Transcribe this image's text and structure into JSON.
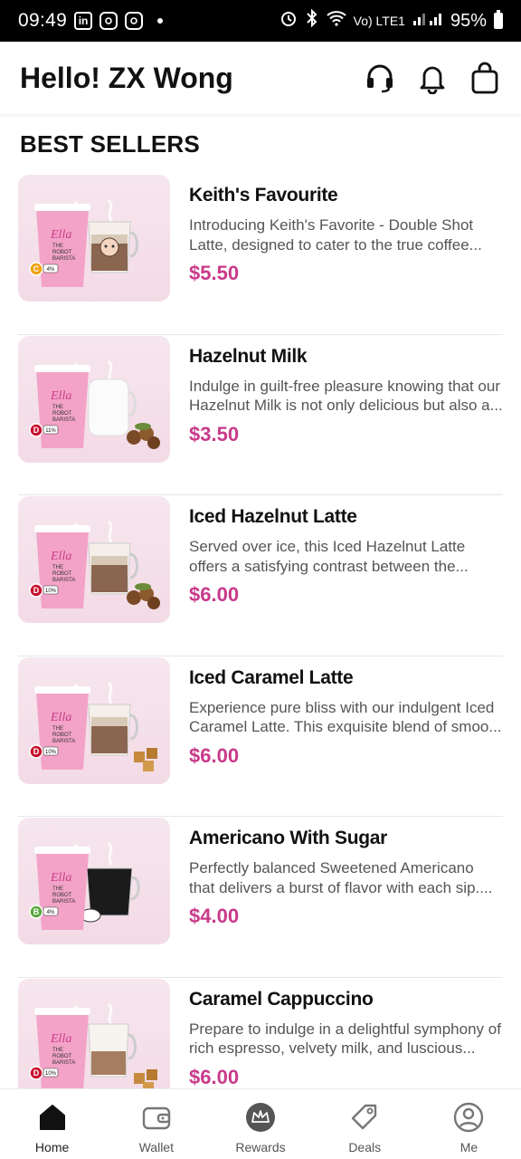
{
  "status_bar": {
    "time": "09:49",
    "battery": "95%",
    "network": "Vo) LTE1"
  },
  "header": {
    "greeting": "Hello! ZX Wong",
    "icons": [
      "headset-icon",
      "bell-icon",
      "bag-icon"
    ]
  },
  "section": {
    "title": "BEST SELLERS"
  },
  "products": [
    {
      "name": "Keith's Favourite",
      "description": "Introducing Keith's Favorite - Double Shot Latte, designed to cater to the true coffee...",
      "price": "$5.50",
      "badge": "C",
      "badge_color": "#f2a20a",
      "badge_pct": "4%",
      "side": "latte-glass-face",
      "garnish": ""
    },
    {
      "name": "Hazelnut Milk",
      "description": "Indulge in guilt-free pleasure knowing that our Hazelnut Milk is not only delicious but also a...",
      "price": "$3.50",
      "badge": "D",
      "badge_color": "#c8102e",
      "badge_pct": "11%",
      "side": "milk-glass",
      "garnish": "hazelnuts"
    },
    {
      "name": "Iced Hazelnut Latte",
      "description": "Served over ice, this Iced Hazelnut Latte offers a satisfying contrast between the...",
      "price": "$6.00",
      "badge": "D",
      "badge_color": "#c8102e",
      "badge_pct": "10%",
      "side": "latte-glass",
      "garnish": "hazelnuts"
    },
    {
      "name": "Iced Caramel Latte",
      "description": "Experience pure bliss with our indulgent Iced Caramel Latte. This exquisite blend of smoo...",
      "price": "$6.00",
      "badge": "D",
      "badge_color": "#c8102e",
      "badge_pct": "10%",
      "side": "latte-glass",
      "garnish": "caramel"
    },
    {
      "name": "Americano With Sugar",
      "description": "Perfectly balanced Sweetened Americano that delivers a burst of flavor with each sip....",
      "price": "$4.00",
      "badge": "B",
      "badge_color": "#5aa83c",
      "badge_pct": "4%",
      "side": "black-coffee-glass",
      "garnish": "sugar"
    },
    {
      "name": "Caramel Cappuccino",
      "description": "Prepare to indulge in a delightful symphony of rich espresso, velvety milk, and luscious...",
      "price": "$6.00",
      "badge": "D",
      "badge_color": "#c8102e",
      "badge_pct": "10%",
      "side": "cappuccino-glass",
      "garnish": "caramel"
    }
  ],
  "cup_label": {
    "brand": "Ella",
    "line1": "THE",
    "line2": "ROBOT",
    "line3": "BARISTA"
  },
  "nav": {
    "items": [
      {
        "label": "Home",
        "icon": "home-icon",
        "active": true
      },
      {
        "label": "Wallet",
        "icon": "wallet-icon",
        "active": false
      },
      {
        "label": "Rewards",
        "icon": "rewards-crown-icon",
        "active": false
      },
      {
        "label": "Deals",
        "icon": "tag-icon",
        "active": false
      },
      {
        "label": "Me",
        "icon": "user-icon",
        "active": false
      }
    ]
  },
  "colors": {
    "accent": "#c93a8a",
    "cup": "#f3a3c7",
    "bg_card": "#f4dee8"
  }
}
